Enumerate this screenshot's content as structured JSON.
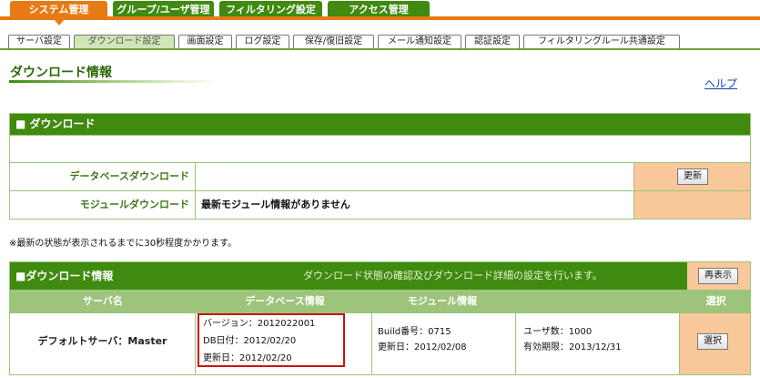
{
  "main_tabs": [
    {
      "label": "システム管理",
      "active": true
    },
    {
      "label": "グループ/ユーザ管理",
      "active": false
    },
    {
      "label": "フィルタリング設定",
      "active": false
    },
    {
      "label": "アクセス管理",
      "active": false
    }
  ],
  "sub_tabs": [
    {
      "label": "サーバ設定",
      "active": false
    },
    {
      "label": "ダウンロード設定",
      "active": true
    },
    {
      "label": "画面設定",
      "active": false
    },
    {
      "label": "ログ設定",
      "active": false
    },
    {
      "label": "保存/復旧設定",
      "active": false
    },
    {
      "label": "メール通知設定",
      "active": false
    },
    {
      "label": "認証設定",
      "active": false
    },
    {
      "label": "フィルタリングルール共通設定",
      "active": false
    }
  ],
  "page": {
    "title": "ダウンロード情報",
    "help_link": "ヘルプ"
  },
  "download_section": {
    "header": "■ ダウンロード",
    "rows": [
      {
        "label": "データベースダウンロード",
        "value": "",
        "button": "更新"
      },
      {
        "label": "モジュールダウンロード",
        "value": "最新モジュール情報がありません",
        "button": ""
      }
    ]
  },
  "note": "※最新の状態が表示されるまでに30秒程度かかります。",
  "info_section": {
    "header": "■ダウンロード情報",
    "description": "ダウンロード状態の確認及びダウンロード詳細の設定を行います。",
    "refresh_button": "再表示",
    "columns": [
      "サーバ名",
      "データベース情報",
      "モジュール情報",
      "選択"
    ],
    "row": {
      "server_name": "デフォルトサーバ：Master",
      "db_version": "バージョン：2012022001",
      "db_date": "DB日付：2012/02/20",
      "db_updated": "更新日：2012/02/20",
      "build_number": "Build番号：0715",
      "module_updated": "更新日：2012/02/08",
      "user_count": "ユーザ数：1000",
      "expiry": "有効期限：2013/12/31",
      "select_button": "選択"
    }
  },
  "colors": {
    "accent_orange": "#e87a14",
    "nav_green": "#3f8a0f",
    "label_green": "#3d7a15",
    "light_green": "#cfe6b6",
    "cell_orange": "#f9c89a",
    "highlight_red": "#cc1111",
    "link_blue": "#1a3fb5"
  }
}
